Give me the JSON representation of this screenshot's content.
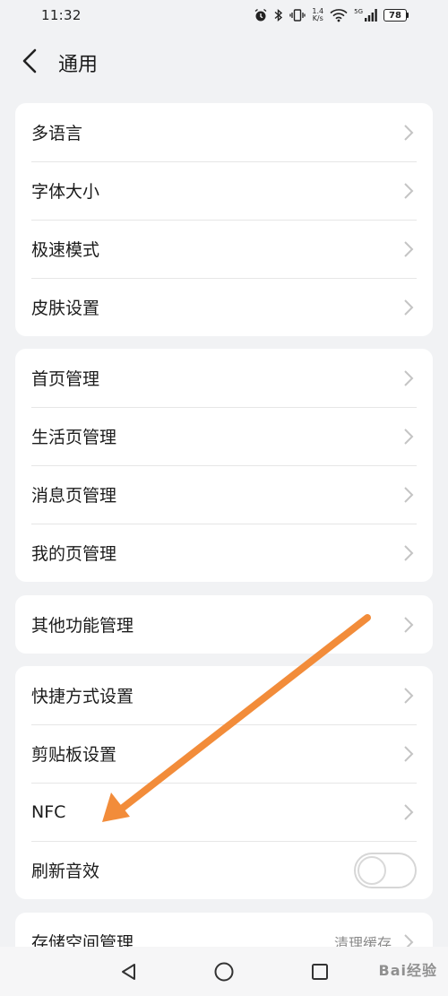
{
  "status_bar": {
    "time": "11:32",
    "speed_top": "1.4",
    "speed_bottom": "K/s",
    "network": "5G",
    "battery": "78"
  },
  "header": {
    "title": "通用"
  },
  "groups": [
    {
      "items": [
        {
          "label": "多语言"
        },
        {
          "label": "字体大小"
        },
        {
          "label": "极速模式"
        },
        {
          "label": "皮肤设置"
        }
      ]
    },
    {
      "items": [
        {
          "label": "首页管理"
        },
        {
          "label": "生活页管理"
        },
        {
          "label": "消息页管理"
        },
        {
          "label": "我的页管理"
        }
      ]
    },
    {
      "items": [
        {
          "label": "其他功能管理"
        }
      ]
    },
    {
      "items": [
        {
          "label": "快捷方式设置"
        },
        {
          "label": "剪贴板设置"
        },
        {
          "label": "NFC"
        },
        {
          "label": "刷新音效",
          "toggle": false
        }
      ]
    },
    {
      "items": [
        {
          "label": "存储空间管理",
          "value": "清理缓存"
        }
      ]
    }
  ],
  "watermark": "Bai经验",
  "colors": {
    "background": "#f1f2f4",
    "card": "#ffffff",
    "annotation_arrow": "#f28c3a"
  }
}
